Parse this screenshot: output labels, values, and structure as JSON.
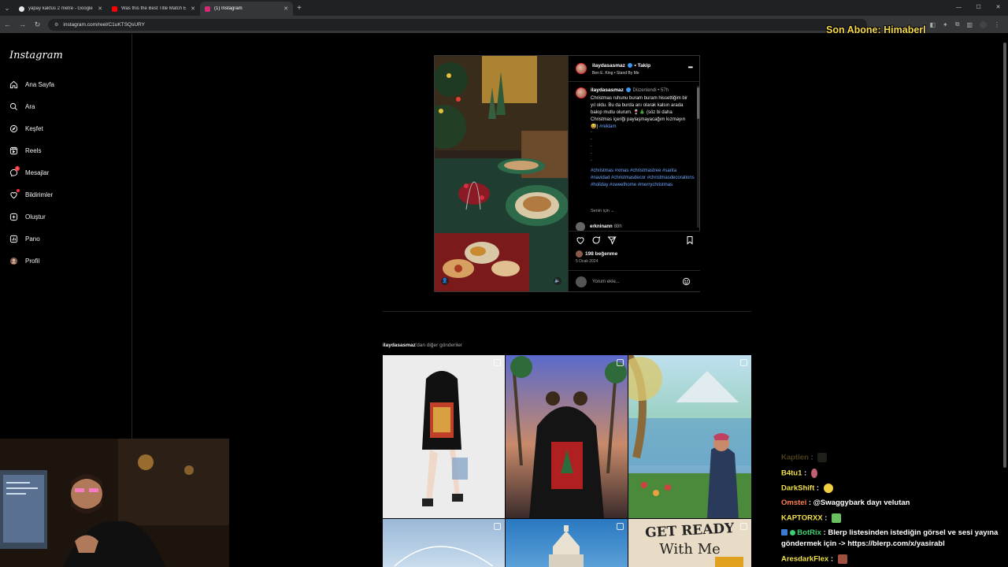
{
  "browser": {
    "tabs": [
      {
        "title": "yapay kaktüs 2 metre - Google",
        "favicon_color": "#e8e8e8",
        "active": false
      },
      {
        "title": "Was this the Best Title Match E",
        "favicon_color": "#ff0000",
        "active": false
      },
      {
        "title": "(1) Instagram",
        "favicon_color": "#d62976",
        "active": true
      }
    ],
    "url": "instagram.com/reel/C1uKTSQsURY",
    "new_tab": "+"
  },
  "stream_overlay": {
    "last_subscriber": "Son Abone: Himaberl"
  },
  "sidebar": {
    "logo": "Instagram",
    "items": [
      {
        "label": "Ana Sayfa",
        "icon": "home-icon"
      },
      {
        "label": "Ara",
        "icon": "search-icon"
      },
      {
        "label": "Keşfet",
        "icon": "compass-icon"
      },
      {
        "label": "Reels",
        "icon": "reels-icon"
      },
      {
        "label": "Mesajlar",
        "icon": "messenger-icon",
        "badge": "1"
      },
      {
        "label": "Bildirimler",
        "icon": "heart-icon"
      },
      {
        "label": "Oluştur",
        "icon": "create-icon"
      },
      {
        "label": "Pano",
        "icon": "dashboard-icon"
      },
      {
        "label": "Profil",
        "icon": "profile-avatar"
      }
    ]
  },
  "post": {
    "username": "ilaydasasmaz",
    "follow": "Takip",
    "separator": "•",
    "song": "Ben E. King • Stand By Me",
    "more": "•••",
    "caption": {
      "username": "ilaydasasmaz",
      "edited": "Düzenlendi •  57h",
      "text": "Christmas ruhunu buram buram hissettiğim bir yıl oldu. Bu da burda anı olarak kalsın arada bakıp mutlu olurum. 🍷🎄 (söz bi daha Christmas içeriği paylaşmayacağım kızmayın 😅)",
      "ad_tag": "#reklam",
      "dots": ".\n.\n.\n.\n.",
      "hashtags": "#christmas #xmas #christmastree #santa #navidad #christmasdecor #christmasdecorations #holiday #sweethome #merrychristmas",
      "for_you": "Senin için ⌄"
    },
    "first_comment": {
      "username": "erkninann",
      "time": "88h"
    },
    "likes": "198 beğenme",
    "date": "5 Ocak 2024",
    "comment_placeholder": "Yorum ekle..."
  },
  "more_posts": {
    "username": "ilaydasasmaz",
    "suffix": "'dan diğer gönderiler"
  },
  "grid_tiles": [
    {
      "name": "grid-tile-hoodie-white",
      "bg": "#e9e9e9"
    },
    {
      "name": "grid-tile-hoodie-palms",
      "bg": "#6a5a8a"
    },
    {
      "name": "grid-tile-painting-lake",
      "bg": "#9bc7a6"
    },
    {
      "name": "grid-tile-wraith",
      "bg": "#aac3dc"
    },
    {
      "name": "grid-tile-building",
      "bg": "#3a88c8"
    },
    {
      "name": "grid-tile-get-ready",
      "bg": "#e8dcc6",
      "text": "GET READY\nWith Me"
    }
  ],
  "chat": [
    {
      "user": "Kaptien",
      "color": "#d8b24a",
      "text": "",
      "emote": true
    },
    {
      "user": "B4tu1",
      "color": "#f0e04a",
      "text": "",
      "emote": true
    },
    {
      "user": "DarkShift",
      "color": "#f0e04a",
      "text": "",
      "emote": true
    },
    {
      "user": "Omstei",
      "color": "#ff7f50",
      "text": "@Swaggybark dayı velutan",
      "emote": false
    },
    {
      "user": "KAPTORXX",
      "color": "#f0e04a",
      "text": "",
      "emote": true
    },
    {
      "user": "BotRix",
      "color": "#3cd070",
      "text": "Blerp listesinden istediğin görsel ve sesi yayına",
      "emote": false
    },
    {
      "user": "",
      "color": "#ffffff",
      "text": "göndermek için -> https://blerp.com/x/yasirabl",
      "emote": false
    },
    {
      "user": "AresdarkFlex",
      "color": "#f0e04a",
      "text": "",
      "emote": true
    }
  ]
}
